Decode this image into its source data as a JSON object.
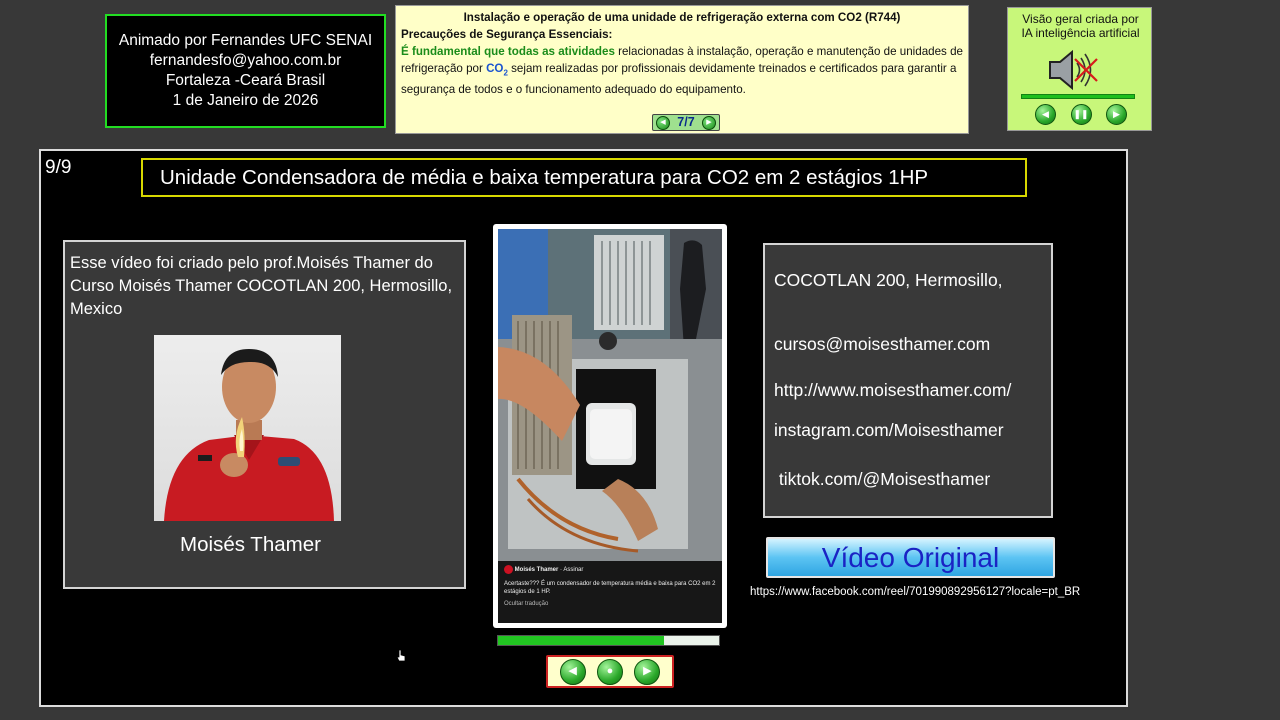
{
  "credits": {
    "lines": [
      "Animado por Fernandes UFC SENAI",
      "fernandesfo@yahoo.com.br",
      "Fortaleza -Ceará Brasil",
      "1 de Janeiro de 2026"
    ]
  },
  "safety": {
    "title": "Instalação e operação de uma unidade de refrigeração externa com CO2 (R744)",
    "subtitle": "Precauções de Segurança Essenciais:",
    "highlight": "É fundamental que todas as atividades",
    "text_1": " relacionadas à instalação, operação e manutenção de unidades de refrigeração por ",
    "co2": "CO",
    "co2_sub": "2",
    "text_2": " sejam realizadas por profissionais devidamente treinados e certificados para garantir a segurança de todos e o funcionamento adequado do equipamento.",
    "pager": "7/7"
  },
  "ai_panel": {
    "caption_1": "Visão geral criada por",
    "caption_2": "IA inteligência artificial",
    "progress": 1.0
  },
  "slide": {
    "number": "9/9",
    "title": "Unidade Condensadora de média e baixa temperatura para CO2 em 2 estágios 1HP",
    "left_text": "Esse vídeo foi criado pelo prof.Moisés Thamer do Curso  Moisés Thamer COCOTLAN 200, Hermosillo, Mexico",
    "person_name": "Moisés Thamer",
    "right_lines": [
      "COCOTLAN 200, Hermosillo,",
      "cursos@moisesthamer.com",
      "http://www.moisesthamer.com/",
      "instagram.com/Moisesthamer",
      " tiktok.com/@Moisesthamer"
    ],
    "original_button": "Vídeo Original",
    "original_url": "https://www.facebook.com/reel/701990892956127?locale=pt_BR"
  },
  "video": {
    "caption_author": "Moisés Thamer",
    "caption_follow": "Assinar",
    "caption_text": "Acertaste??? É um condensador de temperatura média e baixa para CO2 em 2 estágios de 1 HP.",
    "caption_translate": "Ocultar tradução",
    "progress": 0.75
  },
  "colors": {
    "credits_border": "#22dd22",
    "safety_bg": "#ffffc8",
    "safety_highlight": "#1a8c1a",
    "ai_panel_bg": "#c8f77a",
    "title_border": "#d8d800",
    "original_button_text": "#1a23c4"
  },
  "icons": {
    "speaker": "speaker-muted-icon",
    "prev": "prev-icon",
    "pause": "pause-icon",
    "next": "next-icon",
    "stop": "stop-icon",
    "cursor": "hand-cursor-icon"
  }
}
